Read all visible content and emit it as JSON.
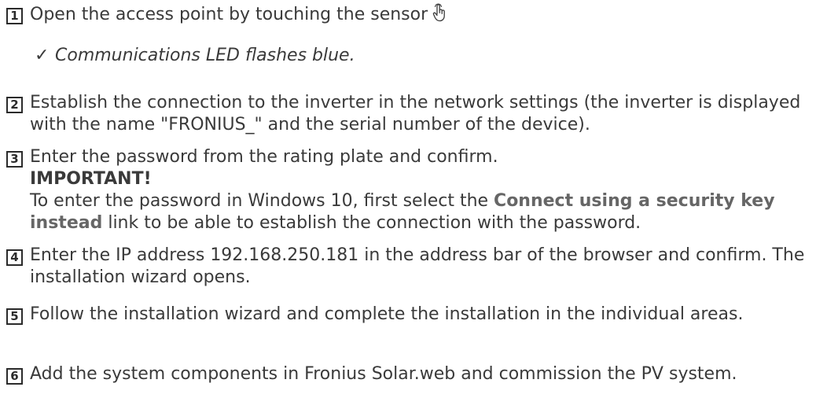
{
  "steps": [
    {
      "number": "1",
      "text": "Open the access point by touching the sensor",
      "result": "Communications LED flashes blue."
    },
    {
      "number": "2",
      "text": "Establish the connection to the inverter in the network settings (the inverter is displayed with the name \"FRONIUS_\" and the serial number of the device)."
    },
    {
      "number": "3",
      "text": "Enter the password from the rating plate and confirm.",
      "important_label": "IMPORTANT!",
      "note_before": "To enter the password in Windows 10, first select the ",
      "note_link": "Connect using a security key instead",
      "note_after": " link to be able to establish the connection with the password."
    },
    {
      "number": "4",
      "text": "Enter the IP address 192.168.250.181 in the address bar of the browser and confirm. The installation wizard opens."
    },
    {
      "number": "5",
      "text": "Follow the installation wizard and complete the installation in the individual areas."
    },
    {
      "number": "6",
      "text": "Add the system components in Fronius Solar.web and commission the PV system."
    }
  ],
  "icons": {
    "check": "✓",
    "sensor": "touch-finger-icon"
  }
}
